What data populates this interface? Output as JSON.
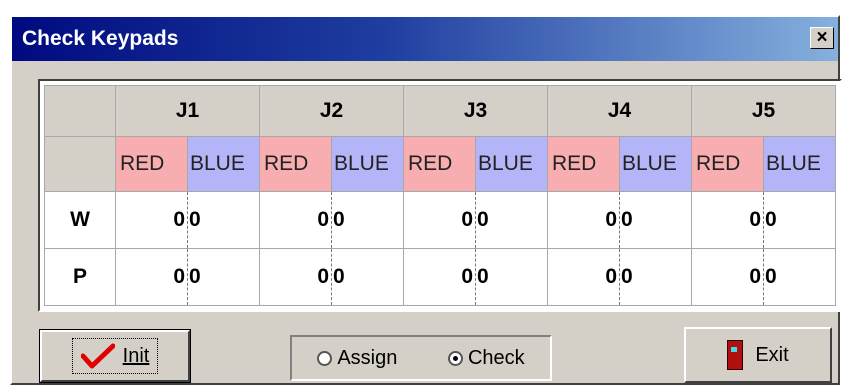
{
  "window": {
    "title": "Check Keypads",
    "close_label": "×"
  },
  "columns": [
    "J1",
    "J2",
    "J3",
    "J4",
    "J5"
  ],
  "subheaders": {
    "red": "RED",
    "blue": "BLUE"
  },
  "rows": [
    {
      "label": "W",
      "values": [
        [
          "0",
          "0"
        ],
        [
          "0",
          "0"
        ],
        [
          "0",
          "0"
        ],
        [
          "0",
          "0"
        ],
        [
          "0",
          "0"
        ]
      ]
    },
    {
      "label": "P",
      "values": [
        [
          "0",
          "0"
        ],
        [
          "0",
          "0"
        ],
        [
          "0",
          "0"
        ],
        [
          "0",
          "0"
        ],
        [
          "0",
          "0"
        ]
      ]
    }
  ],
  "buttons": {
    "init": {
      "label": "Init",
      "icon": "checkmark-icon"
    },
    "exit": {
      "label": "Exit",
      "icon": "door-icon"
    }
  },
  "mode": {
    "options": [
      {
        "label": "Assign",
        "checked": false
      },
      {
        "label": "Check",
        "checked": true
      }
    ]
  },
  "colors": {
    "title_start": "#000a80",
    "title_end": "#86b0de",
    "red_cell": "#f8aeb0",
    "blue_cell": "#b4b4f8"
  }
}
